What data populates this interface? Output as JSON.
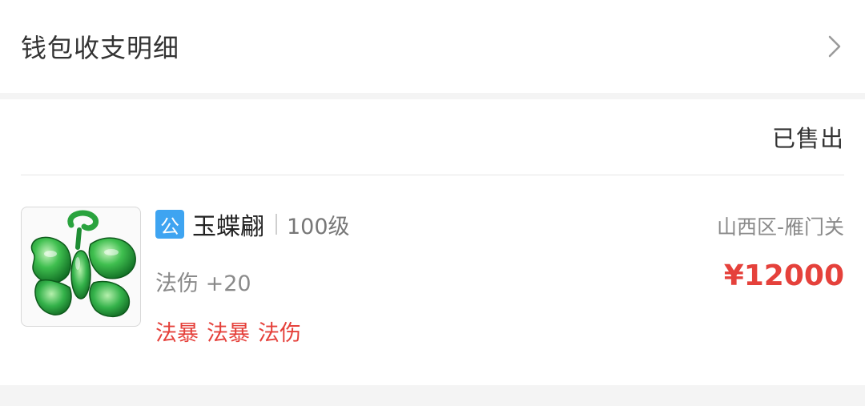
{
  "wallet": {
    "title": "钱包收支明细",
    "chevron_icon": "chevron-right-icon"
  },
  "order": {
    "status": "已售出",
    "item": {
      "icon": "jade-butterfly-pendant-icon",
      "server_badge": "公",
      "name": "玉蝶翩",
      "level": "100级",
      "attribute": "法伤 +20",
      "traits": [
        "法暴",
        "法暴",
        "法伤"
      ]
    },
    "server": "山西区-雁门关",
    "price": "¥12000"
  },
  "colors": {
    "badge_blue": "#3ea4f1",
    "price_red": "#e5413b",
    "background": "#f4f4f4"
  }
}
